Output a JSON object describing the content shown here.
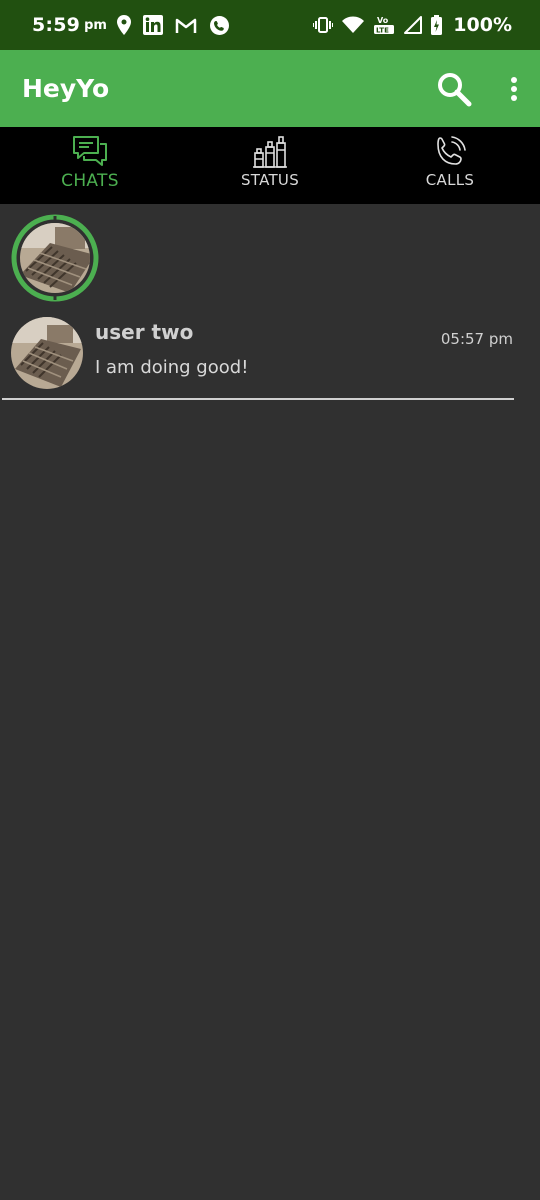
{
  "status_bar": {
    "time": "5:59",
    "ampm": "pm",
    "battery": "100%",
    "icons_left": [
      "location-pin-icon",
      "linkedin-icon",
      "gmail-icon",
      "whatsapp-icon"
    ],
    "icons_right": [
      "vibrate-icon",
      "wifi-icon",
      "volte-icon",
      "signal-icon",
      "battery-icon"
    ]
  },
  "app_bar": {
    "title": "HeyYo",
    "actions": [
      "search-icon",
      "more-vert-icon"
    ]
  },
  "tabs": [
    {
      "label": "CHATS",
      "icon": "chat-bubbles-icon",
      "active": true
    },
    {
      "label": "STATUS",
      "icon": "bottles-icon",
      "active": false
    },
    {
      "label": "CALLS",
      "icon": "phone-call-icon",
      "active": false
    }
  ],
  "chats": [
    {
      "name": "user two",
      "time": "05:57 pm",
      "message": "I am doing good!"
    }
  ],
  "colors": {
    "status_bar": "#215010",
    "primary": "#4caf50",
    "tab_bar": "#000000",
    "background": "#303030",
    "text": "#d0d0d0"
  }
}
